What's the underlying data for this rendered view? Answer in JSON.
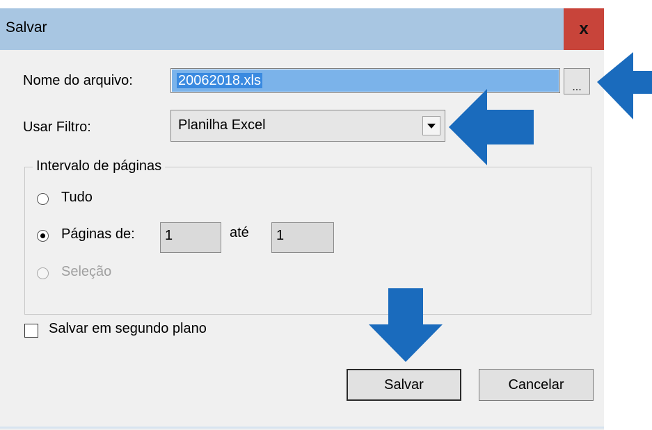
{
  "dialog": {
    "title": "Salvar",
    "close_glyph": "x"
  },
  "filename": {
    "label": "Nome do arquivo:",
    "value": "20062018.xls",
    "browse_label": "..."
  },
  "filter": {
    "label": "Usar Filtro:",
    "value": "Planilha Excel"
  },
  "page_range": {
    "group_title": "Intervalo de páginas",
    "all_label": "Tudo",
    "pages_label": "Páginas de:",
    "from_value": "1",
    "to_label": "até",
    "to_value": "1",
    "selection_label": "Seleção",
    "selected_option": "pages"
  },
  "background_save": {
    "label": "Salvar em segundo plano",
    "checked": false
  },
  "buttons": {
    "save": "Salvar",
    "cancel": "Cancelar"
  },
  "colors": {
    "titlebar": "#a8c6e2",
    "close": "#c8443a",
    "selection": "#7bb3ea",
    "arrow": "#1a6bbd"
  }
}
